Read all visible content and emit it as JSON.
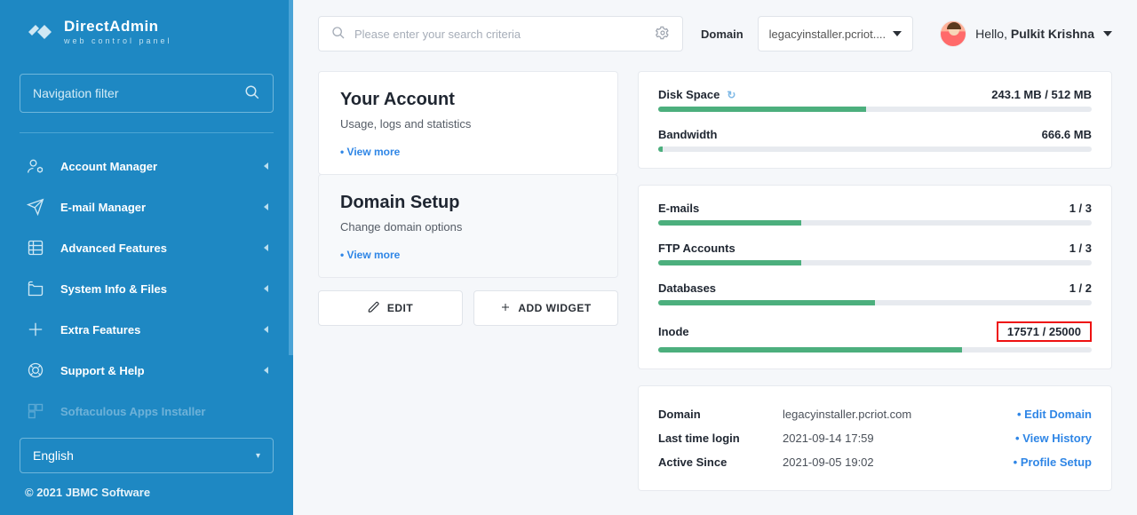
{
  "brand": {
    "name": "DirectAdmin",
    "tagline": "web control panel"
  },
  "nav_filter": {
    "placeholder": "Navigation filter"
  },
  "nav": [
    {
      "id": "account",
      "label": "Account Manager"
    },
    {
      "id": "email",
      "label": "E-mail Manager"
    },
    {
      "id": "advanced",
      "label": "Advanced Features"
    },
    {
      "id": "sysinfo",
      "label": "System Info & Files"
    },
    {
      "id": "extra",
      "label": "Extra Features"
    },
    {
      "id": "support",
      "label": "Support & Help"
    },
    {
      "id": "soft",
      "label": "Softaculous Apps Installer"
    }
  ],
  "language": "English",
  "copyright": "© 2021 JBMC Software",
  "search": {
    "placeholder": "Please enter your search criteria"
  },
  "domain_label": "Domain",
  "domain_selected": "legacyinstaller.pcriot....",
  "user": {
    "greeting": "Hello,",
    "name": "Pulkit Krishna"
  },
  "cards": {
    "account": {
      "title": "Your Account",
      "sub": "Usage, logs and statistics",
      "link": "View more"
    },
    "domain": {
      "title": "Domain Setup",
      "sub": "Change domain options",
      "link": "View more"
    }
  },
  "buttons": {
    "edit": "EDIT",
    "add_widget": "ADD WIDGET"
  },
  "stats1": [
    {
      "label": "Disk Space",
      "value": "243.1 MB / 512 MB",
      "pct": 48,
      "refresh": true
    },
    {
      "label": "Bandwidth",
      "value": "666.6 MB",
      "pct": 1
    }
  ],
  "stats2": [
    {
      "label": "E-mails",
      "value": "1 / 3",
      "pct": 33
    },
    {
      "label": "FTP Accounts",
      "value": "1 / 3",
      "pct": 33
    },
    {
      "label": "Databases",
      "value": "1 / 2",
      "pct": 50
    },
    {
      "label": "Inode",
      "value": "17571 / 25000",
      "pct": 70,
      "highlight": true
    }
  ],
  "info": {
    "rows": [
      {
        "k": "Domain",
        "v": "legacyinstaller.pcriot.com",
        "a": "Edit Domain"
      },
      {
        "k": "Last time login",
        "v": "2021-09-14 17:59",
        "a": "View History"
      },
      {
        "k": "Active Since",
        "v": "2021-09-05 19:02",
        "a": "Profile Setup"
      }
    ]
  }
}
